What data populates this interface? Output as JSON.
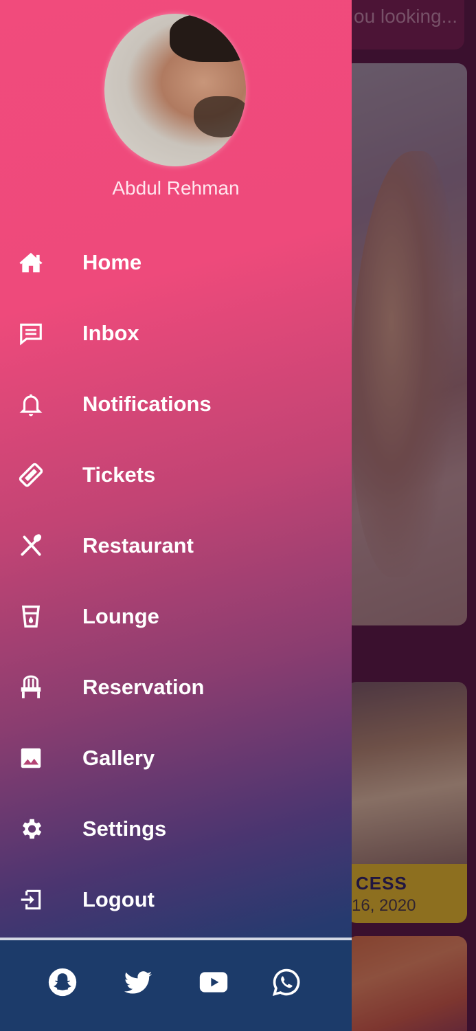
{
  "background": {
    "search_placeholder": "ou looking...",
    "event_card": {
      "title": "CESS",
      "date": "16, 2020"
    }
  },
  "drawer": {
    "user_name": "Abdul Rehman",
    "menu": [
      {
        "label": "Home",
        "icon": "home-icon"
      },
      {
        "label": "Inbox",
        "icon": "inbox-icon"
      },
      {
        "label": "Notifications",
        "icon": "bell-icon"
      },
      {
        "label": "Tickets",
        "icon": "ticket-icon"
      },
      {
        "label": "Restaurant",
        "icon": "utensils-icon"
      },
      {
        "label": "Lounge",
        "icon": "cup-icon"
      },
      {
        "label": "Reservation",
        "icon": "chair-icon"
      },
      {
        "label": "Gallery",
        "icon": "image-icon"
      },
      {
        "label": "Settings",
        "icon": "gear-icon"
      },
      {
        "label": "Logout",
        "icon": "logout-icon"
      }
    ],
    "social": [
      "snapchat-icon",
      "twitter-icon",
      "youtube-icon",
      "whatsapp-icon"
    ]
  },
  "colors": {
    "drawer_top": "#f14b7c",
    "drawer_bottom": "#1d3a6b",
    "social_bar": "#1c3b6a",
    "card_accent": "#e0c21d"
  }
}
